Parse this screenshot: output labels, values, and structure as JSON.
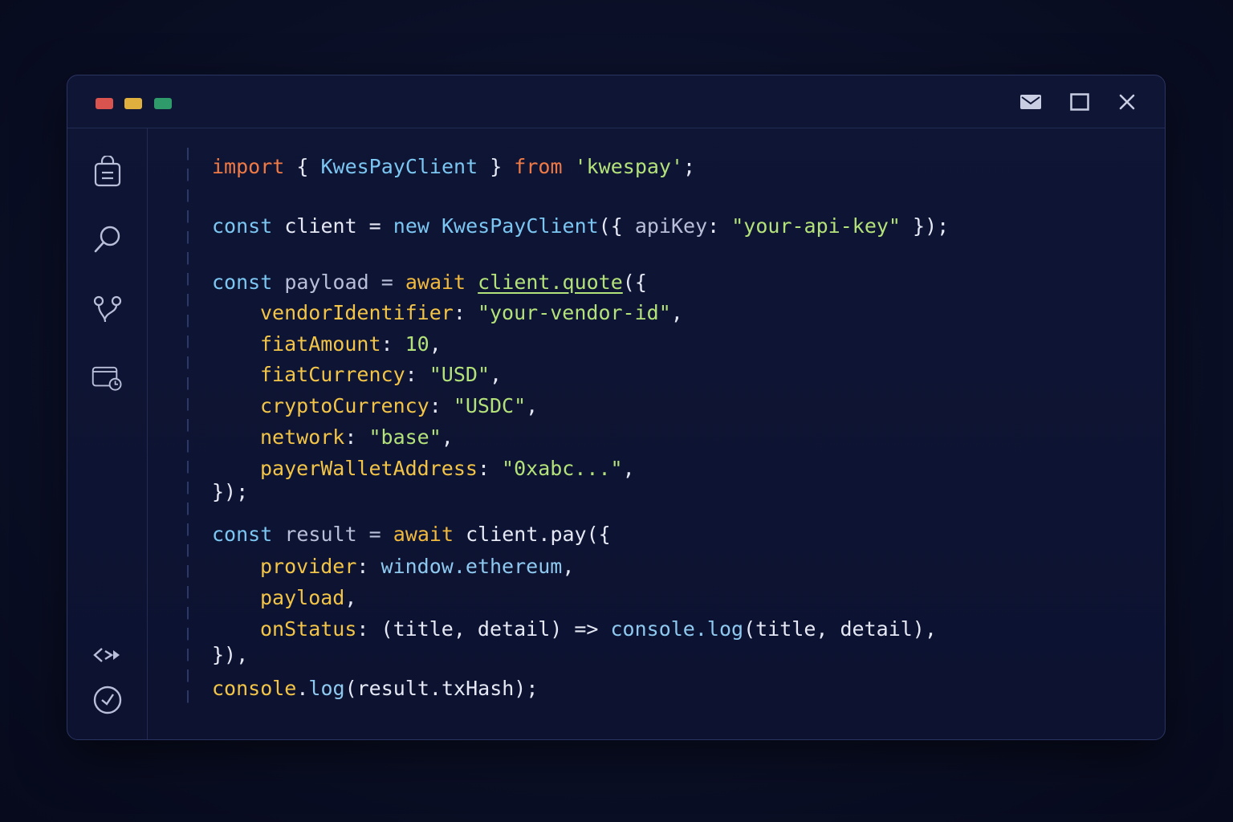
{
  "window": {
    "controls": {
      "mail": "mail-icon",
      "maximize": "maximize-icon",
      "close": "close-icon"
    }
  },
  "sidebar": {
    "items": [
      {
        "icon": "clipboard-lock-icon"
      },
      {
        "icon": "search-icon"
      },
      {
        "icon": "git-branch-icon"
      },
      {
        "icon": "wallet-clock-icon"
      },
      {
        "icon": "code-arrows-icon"
      },
      {
        "icon": "check-circle-icon"
      }
    ]
  },
  "code": {
    "l1": {
      "t1": "import",
      "t2": " { ",
      "t3": "KwesPayClient",
      "t4": " } ",
      "t5": "from",
      "t6": " ",
      "t7": "'kwespay'",
      "t8": ";"
    },
    "l2": {
      "t1": "const",
      "t2": " client = ",
      "t3": "new",
      "t4": " ",
      "t5": "KwesPayClient",
      "t6": "({ ",
      "t7": "apiKey",
      "t8": ": ",
      "t9": "\"your-api-key\"",
      "t10": " });"
    },
    "l3": {
      "t1": "const",
      "t2": " payload = ",
      "t3": "await",
      "t4": " ",
      "t5": "client.quote",
      "t6": "({"
    },
    "l4": {
      "t1": "vendorIdentifier",
      "t2": ": ",
      "t3": "\"your-vendor-id\"",
      "t4": ","
    },
    "l5": {
      "t1": "fiatAmount",
      "t2": ": ",
      "t3": "10",
      "t4": ","
    },
    "l6": {
      "t1": "fiatCurrency",
      "t2": ": ",
      "t3": "\"USD\"",
      "t4": ","
    },
    "l7": {
      "t1": "cryptoCurrency",
      "t2": ": ",
      "t3": "\"USDC\"",
      "t4": ","
    },
    "l8": {
      "t1": "network",
      "t2": ": ",
      "t3": "\"base\"",
      "t4": ","
    },
    "l9": {
      "t1": "payerWalletAddress",
      "t2": ": ",
      "t3": "\"0xabc...\"",
      "t4": ","
    },
    "l10": {
      "t1": "});"
    },
    "l11": {
      "t1": "const",
      "t2": " result = ",
      "t3": "await",
      "t4": " client.pay({"
    },
    "l12": {
      "t1": "provider",
      "t2": ": ",
      "t3": "window.ethereum",
      "t4": ","
    },
    "l13": {
      "t1": "payload",
      "t2": ","
    },
    "l14": {
      "t1": "onStatus",
      "t2": ": (title, detail) => ",
      "t3": "console.log",
      "t4": "(title, detail),"
    },
    "l15": {
      "t1": "}),"
    },
    "l16": {
      "t1": "console",
      "t2": ".",
      "t3": "log",
      "t4": "(result.txHash);"
    }
  },
  "colors": {
    "keyword_orange": "#f07a45",
    "keyword_blue": "#7cc6f2",
    "keyword_yellow": "#f0b93e",
    "string_green": "#b4e27a",
    "property_yellow": "#f2c447",
    "traffic_red": "#d9534f",
    "traffic_yellow": "#e0b03e",
    "traffic_green": "#2f9a6a"
  }
}
